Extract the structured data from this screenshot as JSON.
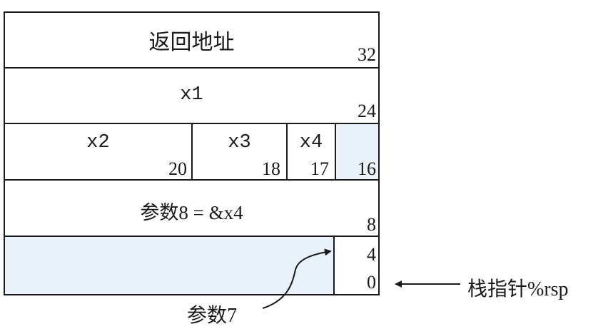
{
  "rows": {
    "r1": {
      "label": "返回地址",
      "offset": "32"
    },
    "r2": {
      "label": "x1",
      "offset": "24"
    },
    "r3": {
      "x2": {
        "label": "x2",
        "offset": "20"
      },
      "x3": {
        "label": "x3",
        "offset": "18"
      },
      "x4": {
        "label": "x4",
        "offset": "17"
      },
      "pad": {
        "offset": "16"
      }
    },
    "r4": {
      "label": "参数8 = &x4",
      "offset": "8"
    },
    "r5": {
      "offset_top": "4",
      "offset_bottom": "0"
    }
  },
  "annotations": {
    "arg7": "参数7",
    "stack_pointer": "栈指针%rsp"
  },
  "colors": {
    "highlight": "#e9f2fb",
    "ink": "#1a1a1a"
  }
}
